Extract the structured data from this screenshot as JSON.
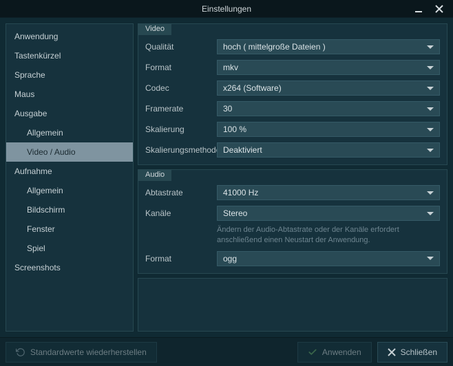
{
  "title": "Einstellungen",
  "sidebar": {
    "items": [
      {
        "label": "Anwendung"
      },
      {
        "label": "Tastenkürzel"
      },
      {
        "label": "Sprache"
      },
      {
        "label": "Maus"
      },
      {
        "label": "Ausgabe"
      },
      {
        "label": "Allgemein"
      },
      {
        "label": "Video / Audio"
      },
      {
        "label": "Aufnahme"
      },
      {
        "label": "Allgemein"
      },
      {
        "label": "Bildschirm"
      },
      {
        "label": "Fenster"
      },
      {
        "label": "Spiel"
      },
      {
        "label": "Screenshots"
      }
    ]
  },
  "video": {
    "title": "Video",
    "quality_label": "Qualität",
    "quality_value": "hoch ( mittelgroße Dateien )",
    "format_label": "Format",
    "format_value": "mkv",
    "codec_label": "Codec",
    "codec_value": "x264 (Software)",
    "framerate_label": "Framerate",
    "framerate_value": "30",
    "scaling_label": "Skalierung",
    "scaling_value": "100 %",
    "scalemethod_label": "Skalierungsmethode",
    "scalemethod_value": "Deaktiviert"
  },
  "audio": {
    "title": "Audio",
    "samplerate_label": "Abtastrate",
    "samplerate_value": "41000 Hz",
    "channels_label": "Kanäle",
    "channels_value": "Stereo",
    "hint": "Ändern der Audio-Abtastrate oder der Kanäle erfordert anschließend einen Neustart der Anwendung.",
    "format_label": "Format",
    "format_value": "ogg"
  },
  "footer": {
    "restore_label": "Standardwerte wiederherstellen",
    "apply_label": "Anwenden",
    "close_label": "Schließen"
  }
}
